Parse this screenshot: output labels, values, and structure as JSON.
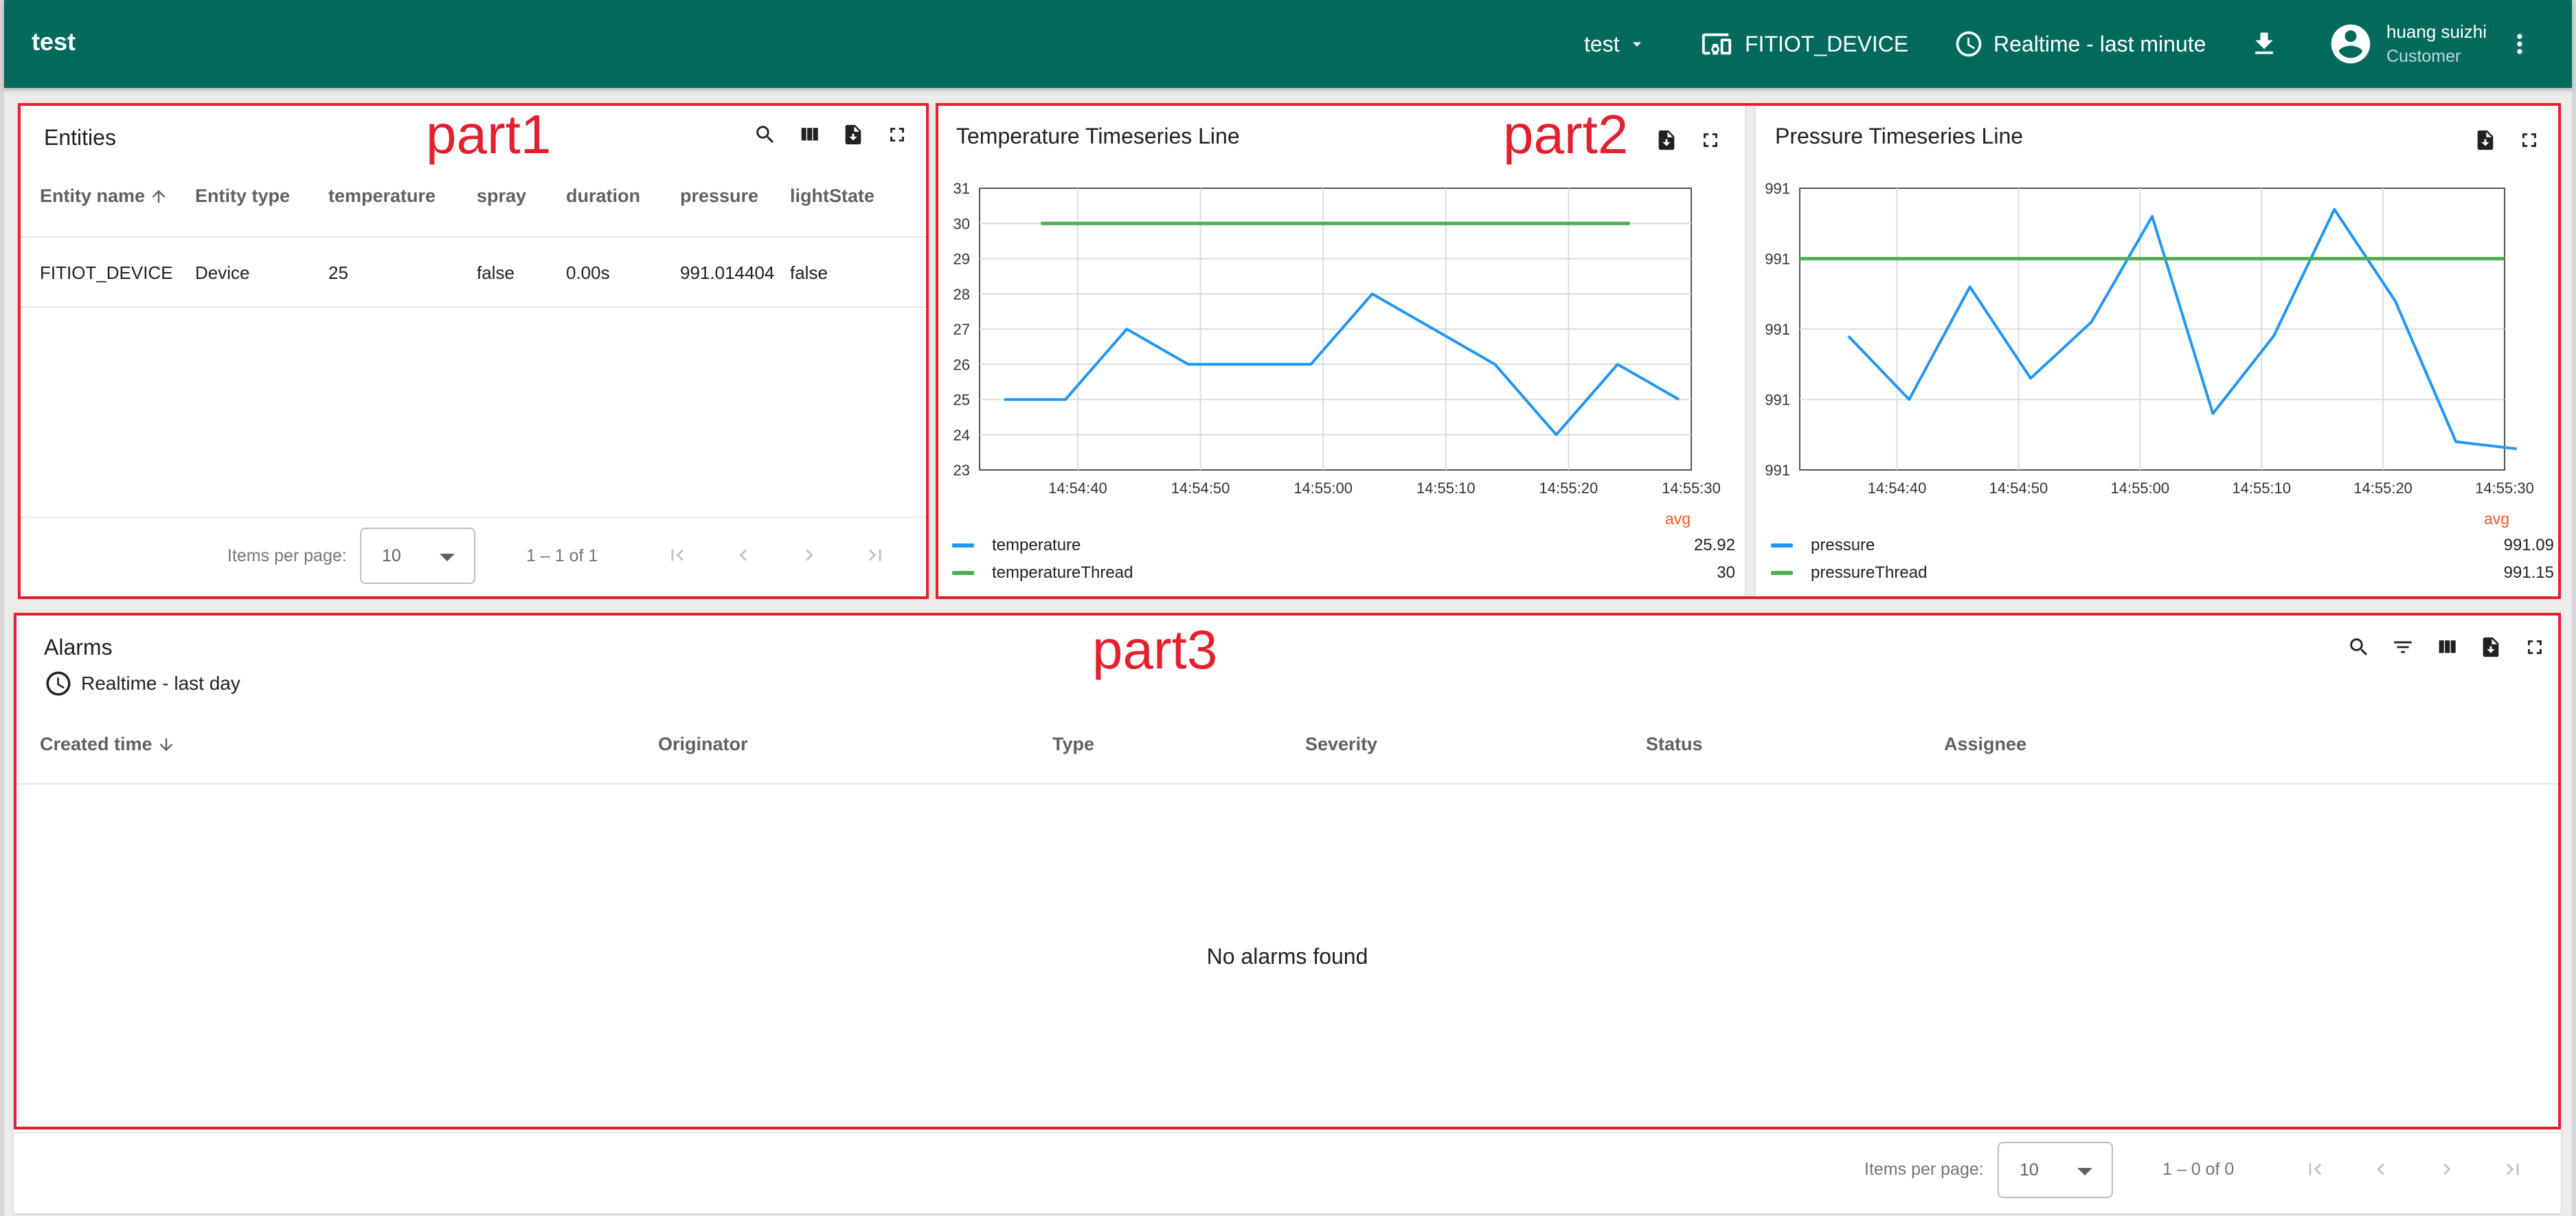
{
  "app": {
    "title": "test"
  },
  "topbar": {
    "state_label": "test",
    "entity_label": "FITIOT_DEVICE",
    "time_label": "Realtime - last minute",
    "user_name": "huang suizhi",
    "user_role": "Customer"
  },
  "annotations": {
    "part1": "part1",
    "part2": "part2",
    "part3": "part3"
  },
  "entities": {
    "title": "Entities",
    "columns": [
      "Entity name",
      "Entity type",
      "temperature",
      "spray",
      "duration",
      "pressure",
      "lightState"
    ],
    "rows": [
      [
        "FITIOT_DEVICE",
        "Device",
        "25",
        "false",
        "0.00s",
        "991.014404",
        "false"
      ]
    ],
    "items_per_page_label": "Items per page:",
    "items_per_page_value": "10",
    "range_label": "1 – 1 of 1"
  },
  "temp_chart": {
    "title": "Temperature Timeseries Line",
    "avg_header": "avg",
    "legend": [
      {
        "name": "temperature",
        "avg": "25.92",
        "color": "#2196f3"
      },
      {
        "name": "temperatureThread",
        "avg": "30",
        "color": "#4caf50"
      }
    ]
  },
  "pressure_chart": {
    "title": "Pressure Timeseries Line",
    "avg_header": "avg",
    "legend": [
      {
        "name": "pressure",
        "avg": "991.09",
        "color": "#2196f3"
      },
      {
        "name": "pressureThread",
        "avg": "991.15",
        "color": "#4caf50"
      }
    ]
  },
  "chart_data": [
    {
      "type": "line",
      "title": "Temperature Timeseries Line",
      "x_ticks": [
        "14:54:40",
        "14:54:50",
        "14:55:00",
        "14:55:10",
        "14:55:20",
        "14:55:30"
      ],
      "y_ticks": [
        "31",
        "30",
        "29",
        "28",
        "27",
        "26",
        "25",
        "24",
        "23"
      ],
      "ylim": [
        23,
        31
      ],
      "xlim": [
        "14:54:32",
        "14:55:30"
      ],
      "series": [
        {
          "name": "temperature",
          "color": "#2196f3",
          "x": [
            "14:54:34",
            "14:54:39",
            "14:54:44",
            "14:54:49",
            "14:54:54",
            "14:54:59",
            "14:55:04",
            "14:55:09",
            "14:55:14",
            "14:55:19",
            "14:55:24",
            "14:55:29"
          ],
          "y": [
            25,
            25,
            27,
            26,
            26,
            26,
            28,
            27,
            26,
            24,
            26,
            25
          ]
        },
        {
          "name": "temperatureThread",
          "color": "#4caf50",
          "x": [
            "14:54:37",
            "14:55:25"
          ],
          "y": [
            30,
            30
          ]
        }
      ],
      "grid": true,
      "legend": "bottom"
    },
    {
      "type": "line",
      "title": "Pressure Timeseries Line",
      "x_ticks": [
        "14:54:40",
        "14:54:50",
        "14:55:00",
        "14:55:10",
        "14:55:20",
        "14:55:30"
      ],
      "y_ticks": [
        "991",
        "991",
        "991",
        "991",
        "991"
      ],
      "ylim": [
        990.9,
        991.3
      ],
      "xlim": [
        "14:54:32",
        "14:55:30"
      ],
      "series": [
        {
          "name": "pressure",
          "color": "#2196f3",
          "x": [
            "14:54:36",
            "14:54:41",
            "14:54:46",
            "14:54:51",
            "14:54:56",
            "14:55:01",
            "14:55:06",
            "14:55:11",
            "14:55:16",
            "14:55:21",
            "14:55:26",
            "14:55:31"
          ],
          "y": [
            991.09,
            991.0,
            991.16,
            991.03,
            991.11,
            991.26,
            990.98,
            991.09,
            991.27,
            991.14,
            990.94,
            990.93
          ]
        },
        {
          "name": "pressureThread",
          "color": "#4caf50",
          "x": [
            "14:54:32",
            "14:55:30"
          ],
          "y": [
            991.2,
            991.2
          ]
        }
      ],
      "grid": true,
      "legend": "bottom"
    }
  ],
  "alarms": {
    "title": "Alarms",
    "time_label": "Realtime - last day",
    "columns": [
      "Created time",
      "Originator",
      "Type",
      "Severity",
      "Status",
      "Assignee"
    ],
    "empty_message": "No alarms found",
    "items_per_page_label": "Items per page:",
    "items_per_page_value": "10",
    "range_label": "1 – 0 of 0"
  }
}
